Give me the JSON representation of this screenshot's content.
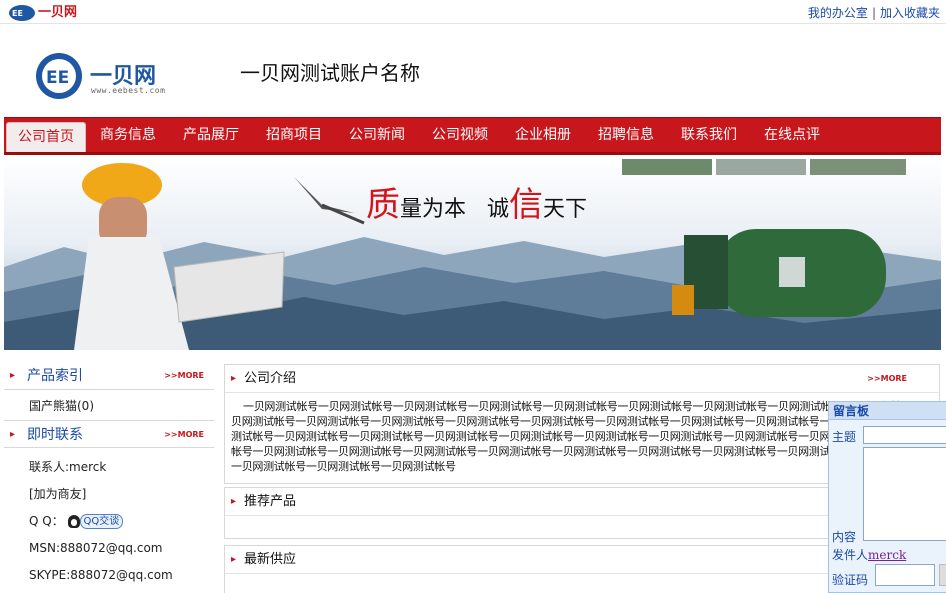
{
  "topbar": {
    "logo_text": "一贝网",
    "link_office": "我的办公室",
    "separator": "|",
    "link_favorite": "加入收藏夹"
  },
  "header": {
    "logo_name": "一贝网",
    "logo_url": "www.eebest.com",
    "company_name": "一贝网测试账户名称"
  },
  "nav": {
    "items": [
      "公司首页",
      "商务信息",
      "产品展厅",
      "招商项目",
      "公司新闻",
      "公司视频",
      "企业相册",
      "招聘信息",
      "联系我们",
      "在线点评"
    ],
    "active_index": 0
  },
  "banner": {
    "slogan_char1": "质",
    "slogan_part1": "量为本",
    "slogan_char2": "信",
    "slogan_part2_pre": "诚",
    "slogan_part2": "天下"
  },
  "sidebar": {
    "more": ">>MORE",
    "product_index_title": "产品索引",
    "product_items": [
      "国产熊猫(0)"
    ],
    "contact_title": "即时联系",
    "contact_person": "联系人:merck",
    "add_partner": "[加为商友]",
    "qq_label": "Q Q：",
    "qq_button": "QQ交谈",
    "msn": "MSN:888072@qq.com",
    "skype": "SKYPE:888072@qq.com"
  },
  "main": {
    "more": ">>MORE",
    "intro_title": "公司介绍",
    "intro_text": "一贝网测试帐号一贝网测试帐号一贝网测试帐号一贝网测试帐号一贝网测试帐号一贝网测试帐号一贝网测试帐号一贝网测试帐号一贝网测试帐号一贝网测试帐号一贝网测试帐号一贝网测试帐号一贝网测试帐号一贝网测试帐号一贝网测试帐号一贝网测试帐号一贝网测试帐号一贝网测试帐号一贝网测试帐号一贝网测试帐号一贝网测试帐号一贝网测试帐号一贝网测试帐号一贝网测试帐号一贝网测试帐号一贝网测试帐号一贝网测试帐号一贝网测试帐号一贝网测试帐号一贝网测试帐号一贝网测试帐号一贝网测试帐号一贝网测试帐号一贝网测试帐号一贝网测试帐号一贝网测试帐号一贝网测试帐号一贝网测试帐号一贝网测试帐号一贝网测试帐号",
    "recommend_title": "推荐产品",
    "supply_title": "最新供应"
  },
  "message_board": {
    "title": "留言板",
    "subject_label": "主题",
    "content_label": "内容",
    "sender_label": "发件人",
    "sender_name": "merck",
    "captcha_label": "验证码"
  },
  "colors": {
    "nav_red": "#c8161d",
    "link_blue": "#1c4aa8"
  }
}
